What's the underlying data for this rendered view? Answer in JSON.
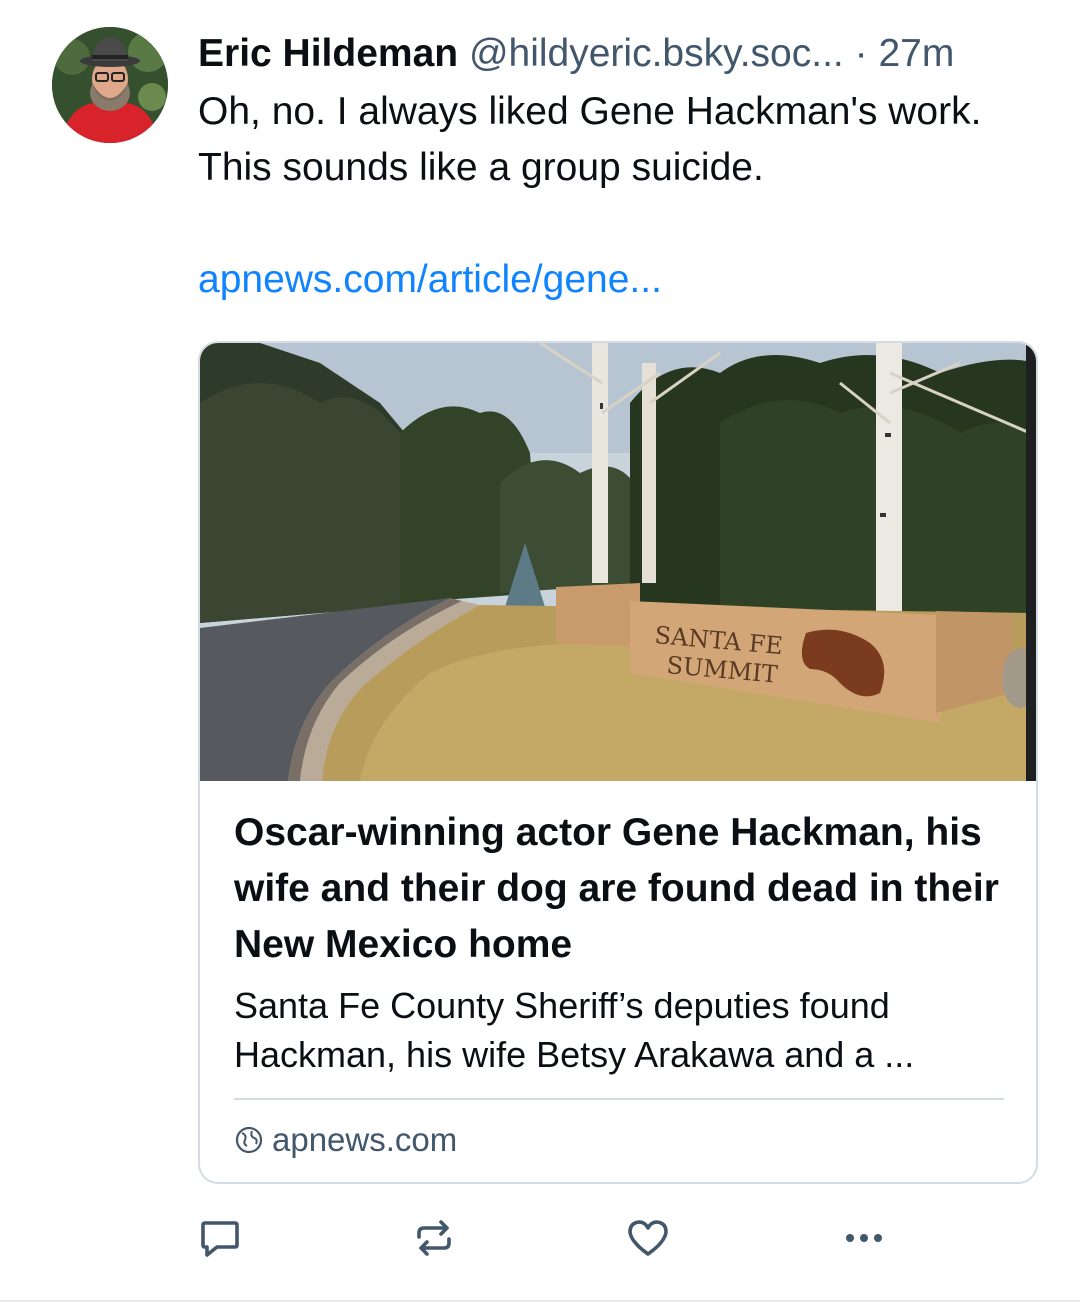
{
  "post": {
    "author_name": "Eric Hildeman",
    "handle": "@hildyeric.bsky.soc...",
    "separator": "·",
    "timestamp": "27m",
    "text": "Oh, no. I always liked Gene Hackman's work. This sounds like a group suicide.",
    "link_text": "apnews.com/article/gene..."
  },
  "card": {
    "image_sign_text": [
      "SANTA FE",
      "SUMMIT"
    ],
    "title": "Oscar-winning actor Gene Hackman, his wife and their dog are found dead in their New Mexico home",
    "description": "Santa Fe County Sheriff’s deputies found Hackman, his wife Betsy Arakawa and a ...",
    "domain": "apnews.com",
    "domain_icon": "globe-icon"
  },
  "actions": {
    "reply_icon": "reply-icon",
    "repost_icon": "repost-icon",
    "like_icon": "heart-icon",
    "more_icon": "more-icon"
  },
  "colors": {
    "link": "#1083fe",
    "muted": "#42576c",
    "border": "#d4dbe2",
    "text": "#0b0f14"
  }
}
